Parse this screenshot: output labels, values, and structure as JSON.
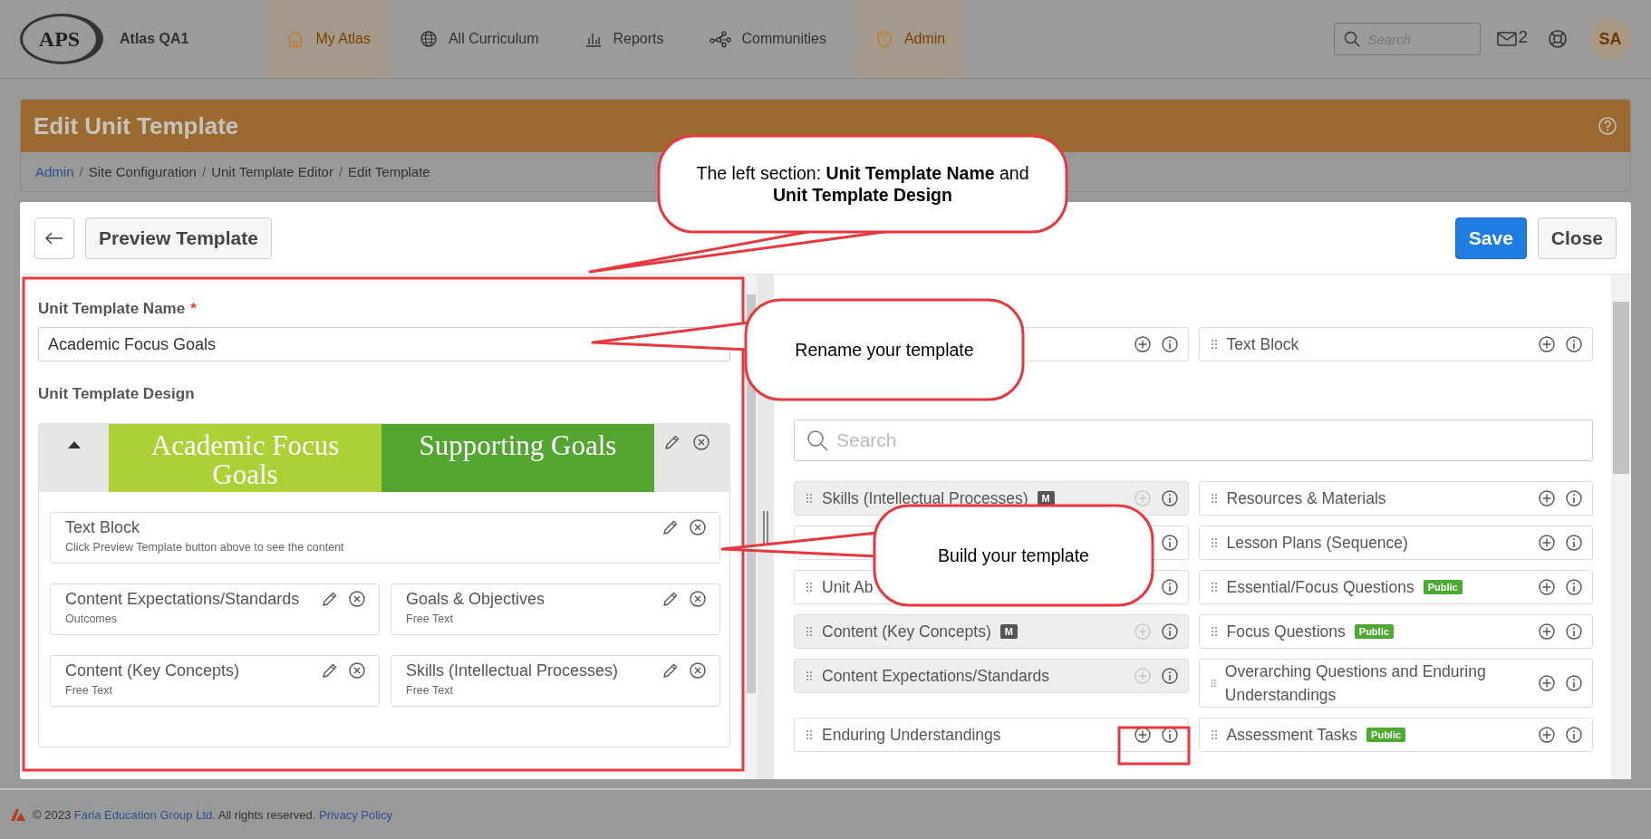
{
  "nav": {
    "logo": "APS",
    "site": "Atlas QA1",
    "items": [
      {
        "label": "My Atlas",
        "selected": true
      },
      {
        "label": "All Curriculum",
        "selected": false
      },
      {
        "label": "Reports",
        "selected": false
      },
      {
        "label": "Communities",
        "selected": false
      },
      {
        "label": "Admin",
        "selected": true
      }
    ],
    "search_placeholder": "Search",
    "mail_count": "2",
    "avatar": "SA"
  },
  "page": {
    "title": "Edit Unit Template",
    "separator": "/",
    "breadcrumb": [
      {
        "label": "Admin",
        "link": true
      },
      {
        "label": "Site Configuration",
        "link": false
      },
      {
        "label": "Unit Template Editor",
        "link": false
      },
      {
        "label": "Edit Template",
        "link": false
      }
    ]
  },
  "toolbar": {
    "preview": "Preview Template",
    "save": "Save",
    "close": "Close"
  },
  "left": {
    "name_label": "Unit Template Name",
    "required": "*",
    "name_value": "Academic Focus Goals",
    "design_label": "Unit Template Design",
    "tabs": [
      {
        "label": "Academic Focus Goals",
        "color": "#acd136"
      },
      {
        "label": "Supporting Goals",
        "color": "#55a630"
      }
    ],
    "blocks": [
      {
        "kind": "wide",
        "title": "Text Block",
        "subtitle": "Click Preview Template button above to see the content"
      },
      {
        "kind": "half",
        "title": "Content Expectations/Standards",
        "subtitle": "Outcomes"
      },
      {
        "kind": "half",
        "title": "Goals & Objectives",
        "subtitle": "Free Text"
      },
      {
        "kind": "half",
        "title": "Content (Key Concepts)",
        "subtitle": "Free Text"
      },
      {
        "kind": "half",
        "title": "Skills (Intellectual Processes)",
        "subtitle": "Free Text"
      }
    ]
  },
  "right": {
    "top": [
      {
        "disabled": false
      },
      {
        "label": "Text Block",
        "disabled": false
      }
    ],
    "search_placeholder": "Search",
    "elements": [
      {
        "label": "Skills (Intellectual Processes)",
        "disabled": true,
        "badge": {
          "text": "M",
          "color": "#555555"
        }
      },
      {
        "label": "Resources & Materials",
        "disabled": false
      },
      {
        "disabled": false
      },
      {
        "label": "Lesson Plans (Sequence)",
        "disabled": false
      },
      {
        "label": "Unit Ab",
        "disabled": false
      },
      {
        "label": "Essential/Focus Questions",
        "disabled": false,
        "badge": {
          "text": "Public",
          "color": "#4caa30"
        }
      },
      {
        "label": "Content (Key Concepts)",
        "disabled": true,
        "badge": {
          "text": "M",
          "color": "#555555"
        }
      },
      {
        "label": "Focus Questions",
        "disabled": false,
        "badge": {
          "text": "Public",
          "color": "#4caa30"
        }
      },
      {
        "label": "Content Expectations/Standards",
        "disabled": true
      },
      {
        "label": "Overarching Questions and Enduring Understandings",
        "disabled": false
      },
      {
        "label": "Enduring Understandings",
        "disabled": false
      },
      {
        "label": "Assessment Tasks",
        "disabled": false,
        "badge": {
          "text": "Public",
          "color": "#4caa30"
        }
      }
    ]
  },
  "footer": {
    "copyright": "© 2023",
    "company": "Faria Education Group Ltd.",
    "rights": "All rights reserved.",
    "privacy": "Privacy Policy"
  },
  "callouts": [
    {
      "text": "The left section: **Unit Template Name** and **Unit Template Design**"
    },
    {
      "text": "Rename your template"
    },
    {
      "text": "Build your template"
    }
  ]
}
